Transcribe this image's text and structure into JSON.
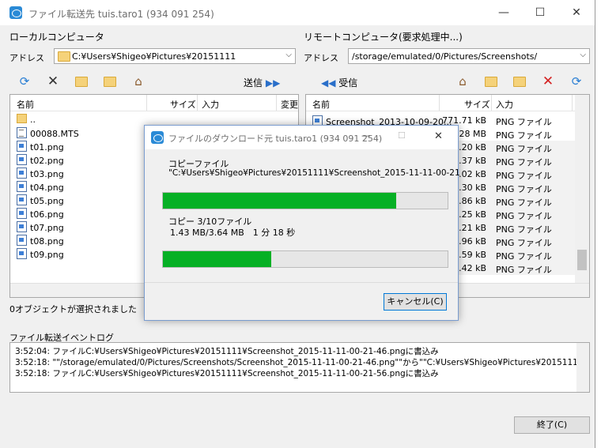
{
  "window": {
    "title": "ファイル転送先 tuis.taro1 (934 091 254)",
    "min": "—",
    "max": "☐",
    "close": "✕"
  },
  "local": {
    "header": "ローカルコンピュータ",
    "address_label": "アドレス",
    "address": "C:¥Users¥Shigeo¥Pictures¥20151111",
    "send_label": "送信",
    "columns": [
      "名前",
      "サイズ",
      "入力",
      "変更"
    ],
    "files": [
      {
        "name": "..",
        "icon": "folder-up-icon"
      },
      {
        "name": "00088.MTS",
        "icon": "video-file-icon"
      },
      {
        "name": "t01.png",
        "icon": "image-file-icon"
      },
      {
        "name": "t02.png",
        "icon": "image-file-icon"
      },
      {
        "name": "t03.png",
        "icon": "image-file-icon"
      },
      {
        "name": "t04.png",
        "icon": "image-file-icon"
      },
      {
        "name": "t05.png",
        "icon": "image-file-icon"
      },
      {
        "name": "t06.png",
        "icon": "image-file-icon"
      },
      {
        "name": "t07.png",
        "icon": "image-file-icon"
      },
      {
        "name": "t08.png",
        "icon": "image-file-icon"
      },
      {
        "name": "t09.png",
        "icon": "image-file-icon"
      }
    ],
    "status": "0オブジェクトが選択されました"
  },
  "remote": {
    "header": "リモートコンピュータ(要求処理中...)",
    "address_label": "アドレス",
    "address": "/storage/emulated/0/Pictures/Screenshots/",
    "receive_label": "受信",
    "columns": [
      "名前",
      "サイズ",
      "入力"
    ],
    "files": [
      {
        "name": "Screenshot_2013-10-09-20...",
        "size": "771.71 kB",
        "type": "PNG ファイル"
      },
      {
        "name": "",
        "size": "1.28 MB",
        "type": "PNG ファイル"
      },
      {
        "name": "",
        "size": "8.20 kB",
        "type": "PNG ファイル"
      },
      {
        "name": "",
        "size": "2.37 kB",
        "type": "PNG ファイル"
      },
      {
        "name": "",
        "size": "4.02 kB",
        "type": "PNG ファイル"
      },
      {
        "name": "",
        "size": "9.30 kB",
        "type": "PNG ファイル"
      },
      {
        "name": "",
        "size": "8.86 kB",
        "type": "PNG ファイル"
      },
      {
        "name": "",
        "size": "0.25 kB",
        "type": "PNG ファイル"
      },
      {
        "name": "",
        "size": "9.21 kB",
        "type": "PNG ファイル"
      },
      {
        "name": "",
        "size": "4.96 kB",
        "type": "PNG ファイル"
      },
      {
        "name": "",
        "size": "3.59 kB",
        "type": "PNG ファイル"
      },
      {
        "name": "",
        "size": "9.42 kB",
        "type": "PNG ファイル"
      }
    ]
  },
  "log": {
    "label": "ファイル転送イベントログ",
    "lines": [
      "3:52:04: ファイルC:¥Users¥Shigeo¥Pictures¥20151111¥Screenshot_2015-11-11-00-21-46.pngに書込み",
      "3:52:18: \"\"/storage/emulated/0/Pictures/Screenshots/Screenshot_2015-11-11-00-21-46.png\"\"から\"\"C:¥Users¥Shigeo¥Pictures¥20151111¥Screens",
      "3:52:18: ファイルC:¥Users¥Shigeo¥Pictures¥20151111¥Screenshot_2015-11-11-00-21-56.pngに書込み"
    ]
  },
  "exit_button": "終了(C)",
  "dialog": {
    "title": "ファイルのダウンロード元 tuis.taro1 (934 091 254)",
    "min": "—",
    "max": "☐",
    "close": "✕",
    "copy_file_label": "コピーファイル",
    "copy_file_path": "\"C:¥Users¥Shigeo¥Pictures¥20151111¥Screenshot_2015-11-11-00-21",
    "file_progress": 0.82,
    "copy_count": "コピー 3/10ファイル",
    "copy_detail": "1.43 MB/3.64 MB　1 分 18 秒",
    "total_progress": 0.38,
    "cancel_button": "キャンセル(C)"
  },
  "colors": {
    "progress": "#06b025",
    "teamviewer": "#2a8ad6"
  }
}
